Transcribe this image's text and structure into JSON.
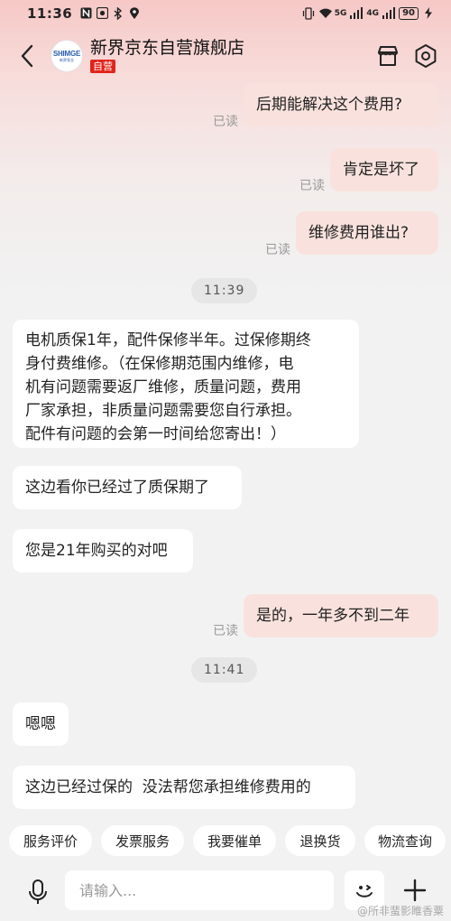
{
  "status_bar": {
    "time": "11:36",
    "network_5g": "5G",
    "network_4g": "4G",
    "battery": "90"
  },
  "header": {
    "shop_name": "新界京东自营旗舰店",
    "self_operated_badge": "自营",
    "logo_text": "SHIMGE",
    "logo_subtext": "新界泵业"
  },
  "messages": [
    {
      "side": "mine",
      "text": "后期能解决这个费用?",
      "read_label": "已读"
    },
    {
      "side": "mine",
      "text": "肯定是坏了",
      "read_label": "已读"
    },
    {
      "side": "mine",
      "text": "维修费用谁出?",
      "read_label": "已读"
    },
    {
      "side": "time",
      "text": "11:39"
    },
    {
      "side": "theirs",
      "lines": [
        "电机质保1年，配件保修半年。过保修期终",
        "身付费维修。（在保修期范围内维修，电",
        "机有问题需要返厂维修，质量问题，费用",
        "厂家承担，非质量问题需要您自行承担。",
        "配件有问题的会第一时间给您寄出！）"
      ]
    },
    {
      "side": "theirs",
      "text": "这边看你已经过了质保期了"
    },
    {
      "side": "theirs",
      "text": "您是21年购买的对吧"
    },
    {
      "side": "mine",
      "text": "是的，一年多不到二年",
      "read_label": "已读"
    },
    {
      "side": "time",
      "text": "11:41"
    },
    {
      "side": "theirs",
      "text": "嗯嗯"
    },
    {
      "side": "theirs",
      "text": "这边已经过保的  没法帮您承担维修费用的"
    }
  ],
  "quick_actions": [
    "服务评价",
    "发票服务",
    "我要催单",
    "退换货",
    "物流查询"
  ],
  "input": {
    "placeholder": "请输入..."
  },
  "watermark": "@所非蜚影睢香粟",
  "colors": {
    "my_bubble": "#f9e2dd",
    "their_bubble": "#ffffff",
    "badge_red": "#e2231a",
    "background": "#f2f2f2"
  },
  "icons": [
    "back-arrow-icon",
    "store-icon",
    "settings-hexagon-icon",
    "microphone-icon",
    "emoji-icon",
    "plus-icon"
  ]
}
